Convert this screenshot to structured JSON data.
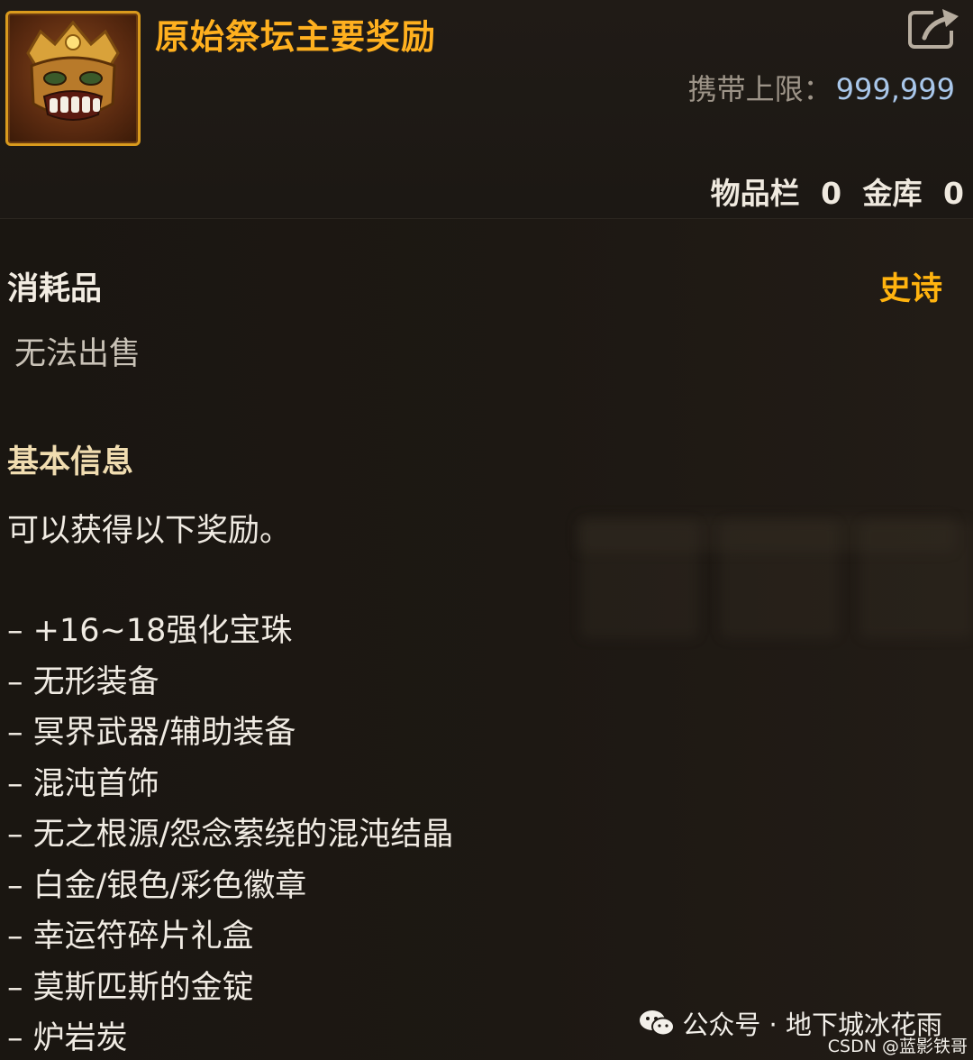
{
  "header": {
    "icon_name": "golden-mask-icon",
    "title": "原始祭坛主要奖励",
    "share_icon": "share-export-icon",
    "limit_label": "携带上限：",
    "limit_value": "999,999",
    "inventory_label": "物品栏",
    "inventory_count": "0",
    "vault_label": "金库",
    "vault_count": "0"
  },
  "item": {
    "category": "消耗品",
    "rarity": "史诗",
    "rarity_color": "#ffb30f",
    "sell_status": "无法出售",
    "section_title": "基本信息",
    "description": "可以获得以下奖励。",
    "rewards": [
      "– +16~18强化宝珠",
      "– 无形装备",
      "– 冥界武器/辅助装备",
      "– 混沌首饰",
      "– 无之根源/怨念萦绕的混沌结晶",
      "– 白金/银色/彩色徽章",
      "– 幸运符碎片礼盒",
      "– 莫斯匹斯的金锭",
      "– 炉岩炭"
    ]
  },
  "watermark": {
    "icon_name": "wechat-icon",
    "text": "公众号 · 地下城冰花雨",
    "credit": "CSDN @蓝影铁哥"
  }
}
